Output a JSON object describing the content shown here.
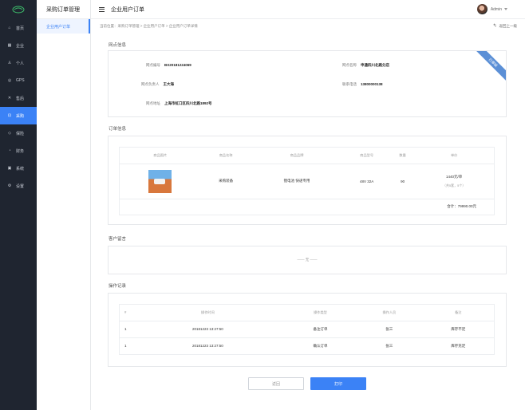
{
  "app": {
    "colors": {
      "sidebar": "#1f2530",
      "accent": "#3b82f6",
      "ribbon": "#5b8fd6"
    }
  },
  "nav": {
    "items": [
      {
        "label": "首页",
        "icon": "home-icon"
      },
      {
        "label": "企业",
        "icon": "building-icon"
      },
      {
        "label": "个人",
        "icon": "user-icon"
      },
      {
        "label": "GPS",
        "icon": "location-icon"
      },
      {
        "label": "售后",
        "icon": "tools-icon"
      },
      {
        "label": "采购",
        "icon": "cart-icon",
        "active": true
      },
      {
        "label": "保险",
        "icon": "shield-icon"
      },
      {
        "label": "财务",
        "icon": "finance-icon"
      },
      {
        "label": "系统",
        "icon": "system-icon"
      },
      {
        "label": "设置",
        "icon": "gear-icon"
      }
    ]
  },
  "subnav": {
    "title": "采购订单管理",
    "item": "企业用户订单"
  },
  "topbar": {
    "title": "企业用户订单",
    "username": "Admin"
  },
  "breadcrumb": "当前位置：采购订单管理 > 企业用户订单 > 企业用户订单详情",
  "back_label": "返回上一级",
  "outlet": {
    "section_title": "网点信息",
    "ribbon": "已审核",
    "code_label": "网点编号",
    "code_value": "BX20181224069",
    "name_label": "网点名称",
    "name_value": "申通四川北路分店",
    "manager_label": "网点负责人",
    "manager_value": "王大海",
    "phone_label": "联系电话",
    "phone_value": "13800000138",
    "address_label": "网点地址",
    "address_value": "上海市虹口区四川北路1892号"
  },
  "order": {
    "section_title": "订单信息",
    "headers": [
      "商品图片",
      "商品名称",
      "商品品牌",
      "商品型号",
      "数量",
      "单价"
    ],
    "row": {
      "name": "采购装备",
      "brand": "锂电池 快递专用",
      "model": "48V 32A",
      "qty": "90",
      "price": "1440元/单",
      "price_note": "（共5套，5个）"
    },
    "total": "合计：79990.00元"
  },
  "message": {
    "section_title": "客户留言",
    "empty": "—— 无 ——"
  },
  "records": {
    "section_title": "操作记录",
    "headers": [
      "#",
      "操作时间",
      "操作类型",
      "操作人员",
      "备注"
    ],
    "rows": [
      {
        "no": "1",
        "time": "20181223 13:27:50",
        "type": "备注订单",
        "operator": "张三",
        "note": "库存不足"
      },
      {
        "no": "1",
        "time": "20181223 13:27:50",
        "type": "确认订单",
        "operator": "张三",
        "note": "库存充足"
      }
    ]
  },
  "buttons": {
    "back": "返回",
    "print": "打印"
  }
}
